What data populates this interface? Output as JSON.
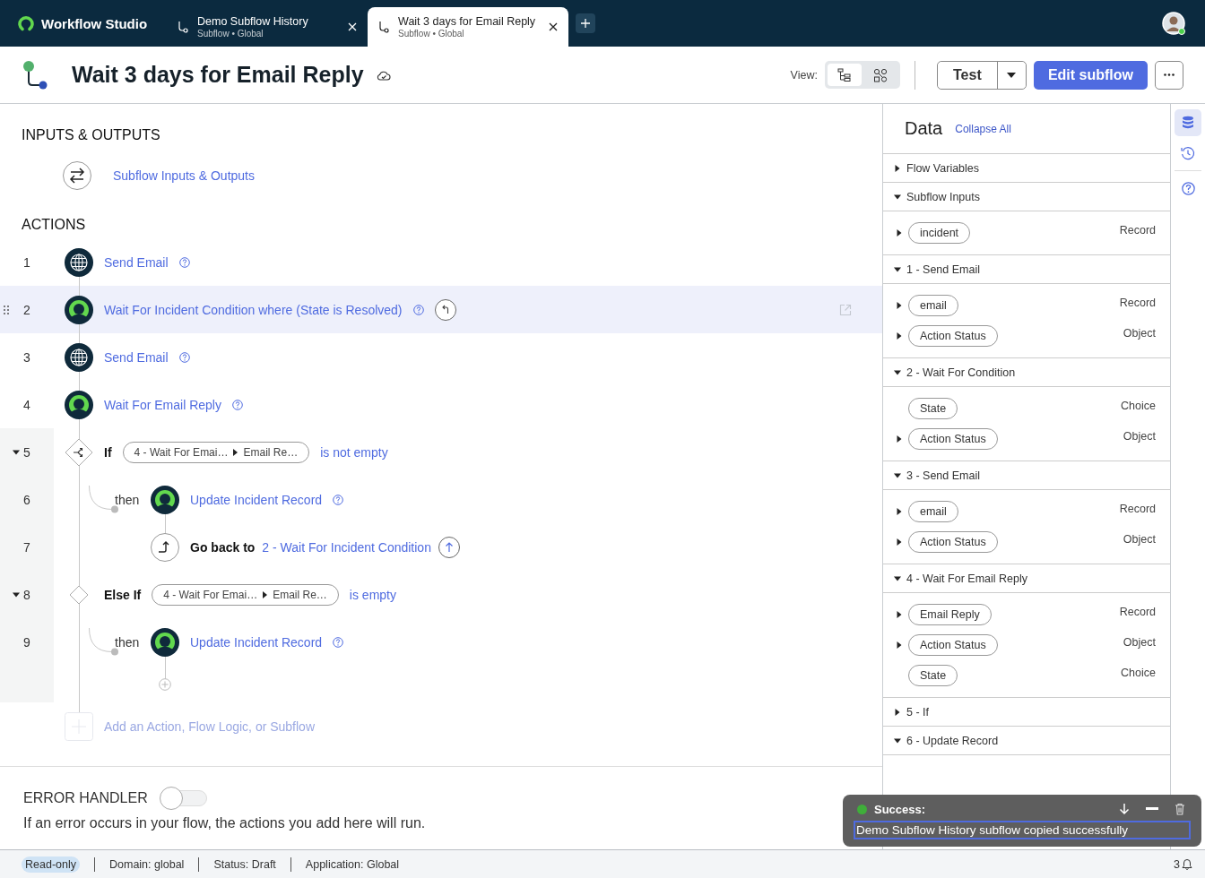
{
  "app": {
    "name": "Workflow Studio"
  },
  "tabs": [
    {
      "title": "Demo Subflow History",
      "subtitle": "Subflow • Global",
      "selected": false
    },
    {
      "title": "Wait 3 days for Email Reply",
      "subtitle": "Subflow • Global",
      "selected": true
    }
  ],
  "header": {
    "title": "Wait 3 days for Email Reply",
    "view_label": "View:",
    "view_options": [
      {
        "kind": "tree",
        "selected": true
      },
      {
        "kind": "diagram",
        "selected": false
      }
    ],
    "test_button": "Test",
    "edit_button": "Edit subflow"
  },
  "inputs_outputs": {
    "heading": "INPUTS & OUTPUTS",
    "link": "Subflow Inputs & Outputs"
  },
  "actions": {
    "heading": "ACTIONS",
    "rows": [
      {
        "number": "1",
        "kind": "email",
        "label": "Send Email",
        "selected": false
      },
      {
        "number": "2",
        "kind": "wait",
        "label": "Wait For Incident Condition where (State is Resolved)",
        "selected": true
      },
      {
        "number": "3",
        "kind": "email",
        "label": "Send Email",
        "selected": false
      },
      {
        "number": "4",
        "kind": "wait",
        "label": "Wait For Email Reply",
        "selected": false
      },
      {
        "number": "5",
        "kind": "if",
        "keyword": "If",
        "expanded": true,
        "pill": [
          "4 - Wait For Emai…",
          "Email Re…"
        ],
        "condition": "is not empty",
        "selected": false,
        "children": [
          {
            "number": "6",
            "kind": "then",
            "keyword": "then",
            "label": "Update Incident Record",
            "selected": false
          },
          {
            "number": "7",
            "kind": "goback",
            "keyword": "Go back to",
            "target": "2 - Wait For Incident Condition",
            "selected": false
          }
        ]
      },
      {
        "number": "8",
        "kind": "else_if",
        "keyword": "Else If",
        "expanded": true,
        "pill": [
          "4 - Wait For Emai…",
          "Email Re…"
        ],
        "condition": "is empty",
        "selected": false,
        "children": [
          {
            "number": "9",
            "kind": "then",
            "keyword": "then",
            "label": "Update Incident Record",
            "selected": false
          }
        ]
      }
    ],
    "add_placeholder": "Add an Action, Flow Logic, or Subflow"
  },
  "error_handler": {
    "heading": "ERROR HANDLER",
    "on": false,
    "description": "If an error occurs in your flow, the actions you add here will run."
  },
  "data_panel": {
    "title": "Data",
    "collapse_link": "Collapse All",
    "sections": [
      {
        "title": "Flow Variables",
        "expanded": false
      },
      {
        "title": "Subflow Inputs",
        "expanded": true,
        "items": [
          {
            "name": "incident",
            "type": "Record",
            "expandable": true
          }
        ]
      },
      {
        "title": "1 - Send Email",
        "expanded": true,
        "items": [
          {
            "name": "email",
            "type": "Record",
            "expandable": true
          },
          {
            "name": "Action Status",
            "type": "Object",
            "expandable": true
          }
        ]
      },
      {
        "title": "2 - Wait For Condition",
        "expanded": true,
        "items": [
          {
            "name": "State",
            "type": "Choice",
            "expandable": false
          },
          {
            "name": "Action Status",
            "type": "Object",
            "expandable": true
          }
        ]
      },
      {
        "title": "3 - Send Email",
        "expanded": true,
        "items": [
          {
            "name": "email",
            "type": "Record",
            "expandable": true
          },
          {
            "name": "Action Status",
            "type": "Object",
            "expandable": true
          }
        ]
      },
      {
        "title": "4 - Wait For Email Reply",
        "expanded": true,
        "items": [
          {
            "name": "Email Reply",
            "type": "Record",
            "expandable": true
          },
          {
            "name": "Action Status",
            "type": "Object",
            "expandable": true
          },
          {
            "name": "State",
            "type": "Choice",
            "expandable": false
          }
        ]
      },
      {
        "title": "5 - If",
        "expanded": false
      },
      {
        "title": "6 - Update Record",
        "expanded": true
      }
    ]
  },
  "rail": [
    {
      "kind": "data",
      "selected": true
    },
    {
      "kind": "history",
      "selected": false
    },
    {
      "kind": "help",
      "selected": false
    }
  ],
  "toast": {
    "title": "Success:",
    "message": "Demo Subflow History subflow copied successfully"
  },
  "status_bar": {
    "badge": "Read-only",
    "items": [
      "Domain: global",
      "Status: Draft",
      "Application: Global"
    ],
    "notifications": "3"
  }
}
